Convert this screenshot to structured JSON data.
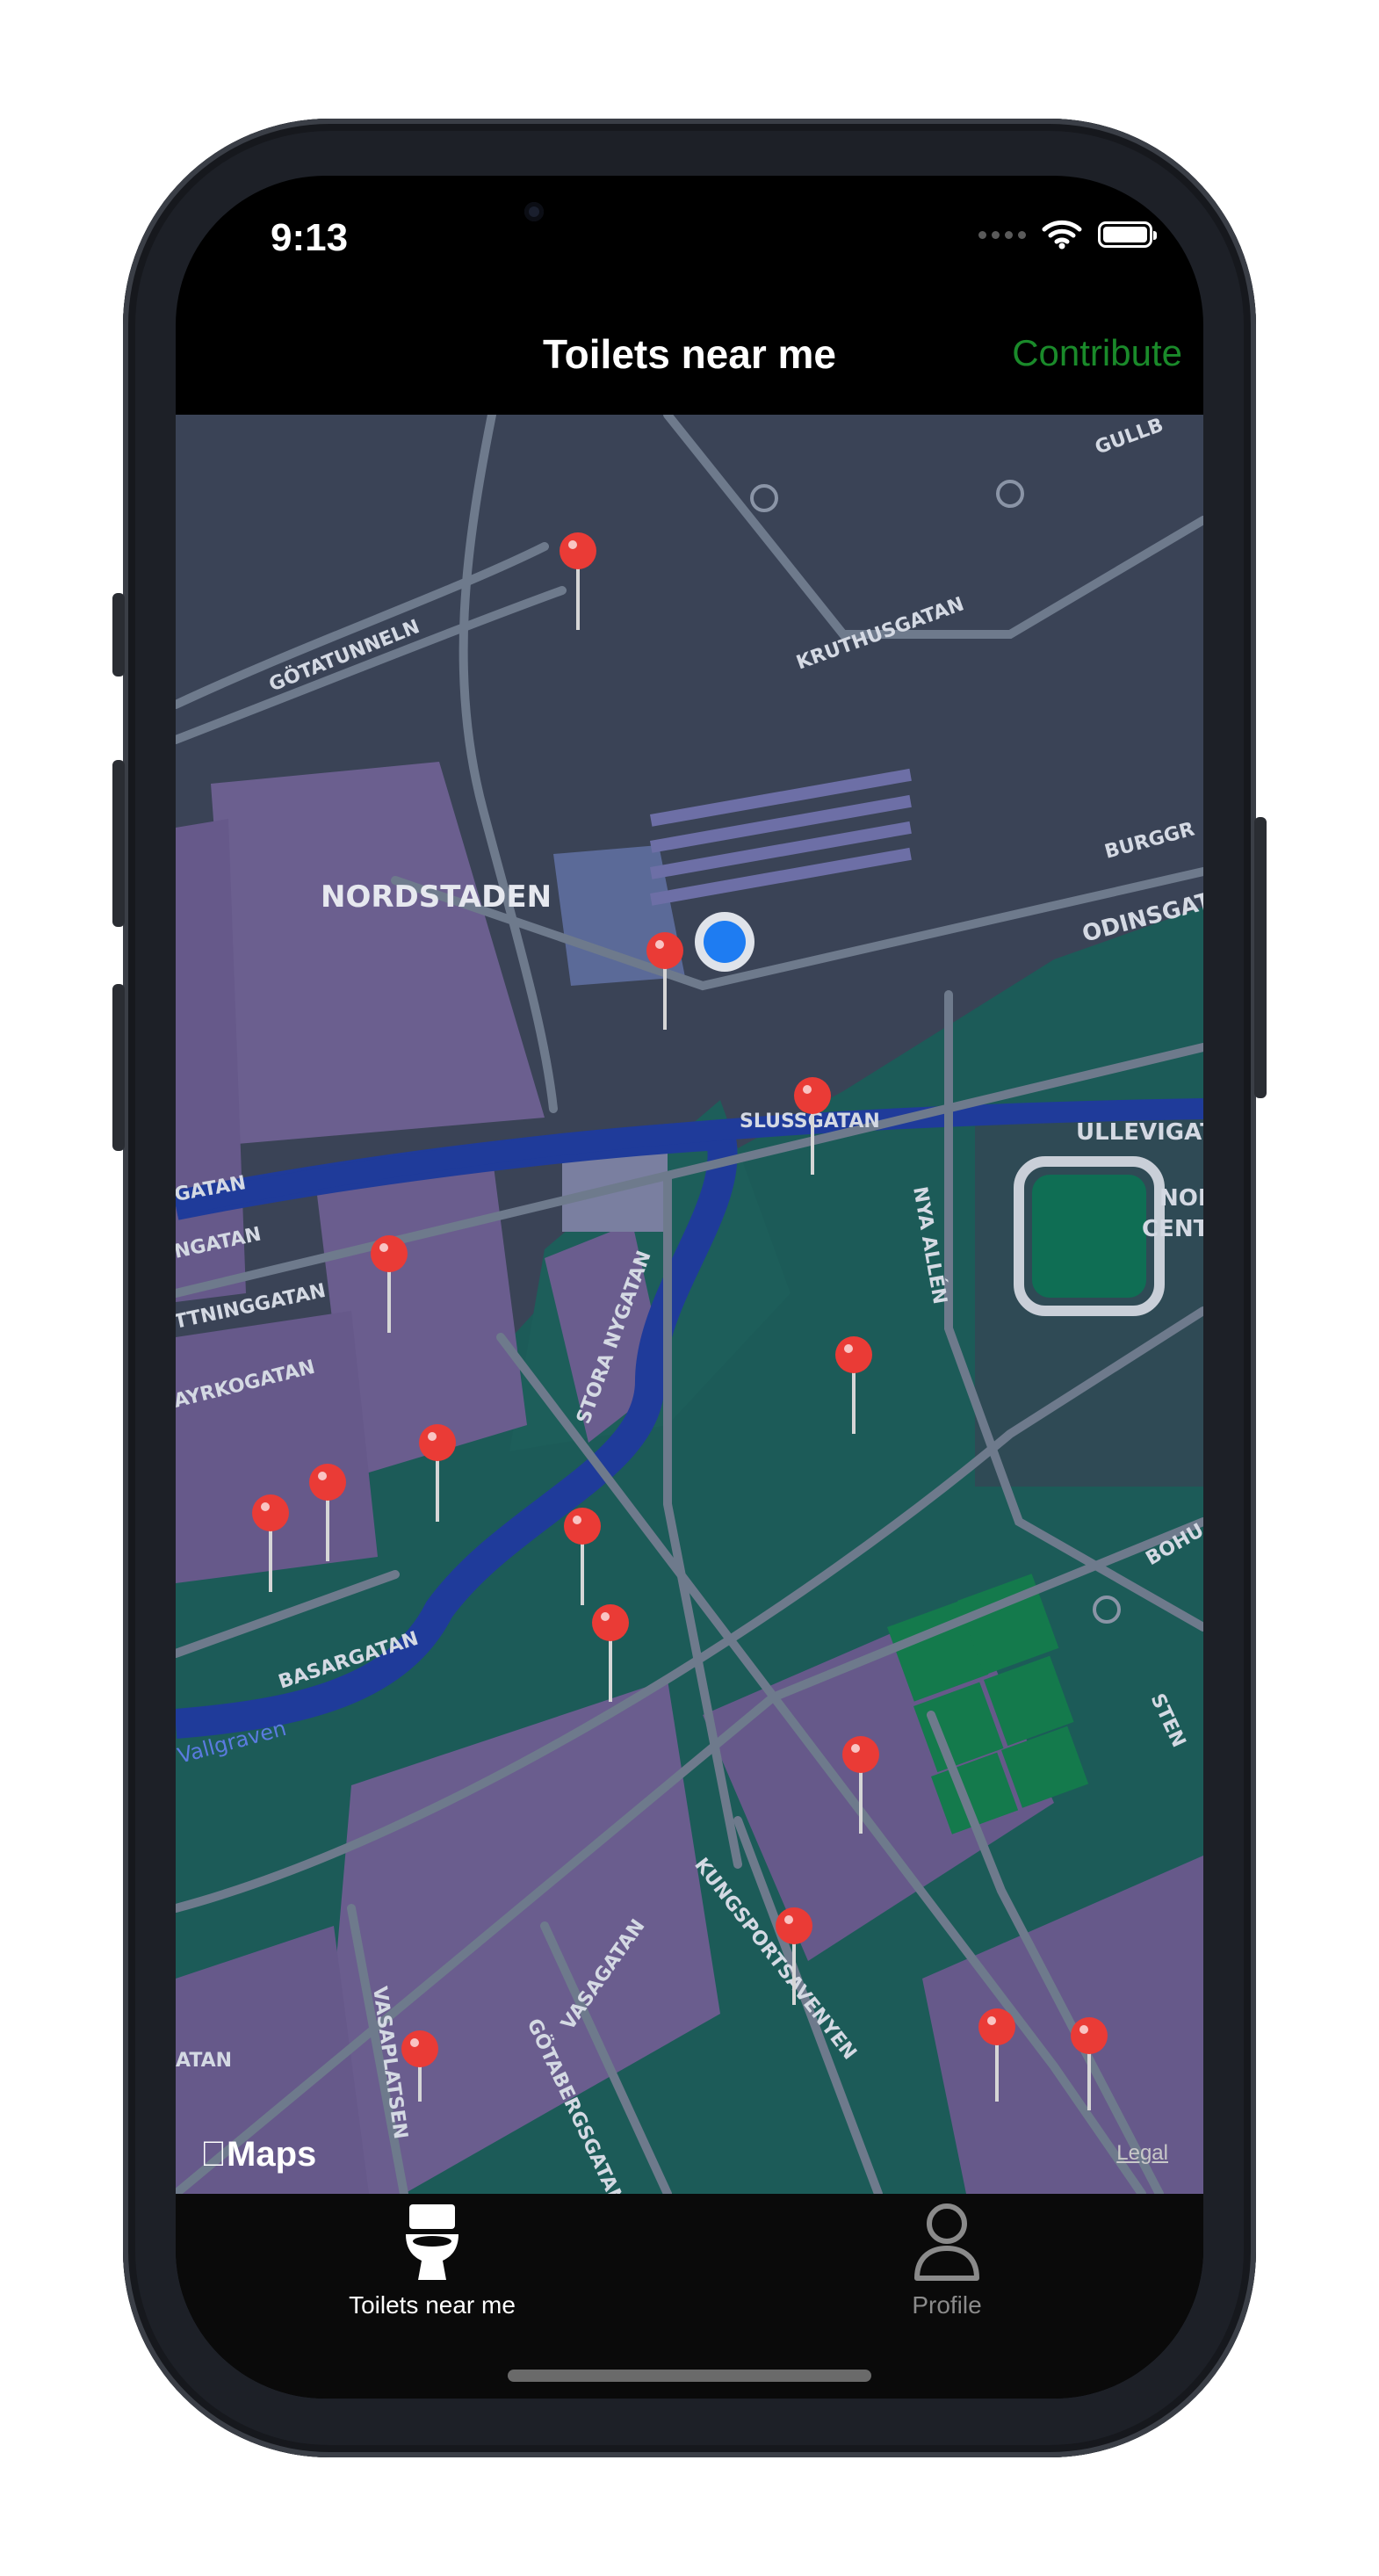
{
  "status_bar": {
    "time": "9:13"
  },
  "nav": {
    "title": "Toilets near me",
    "contribute_label": "Contribute",
    "accent_color": "#1a8a2a"
  },
  "map": {
    "attribution": "Maps",
    "legal_label": "Legal",
    "street_labels": [
      "GÖTATUNNELN",
      "KRUTHUSGATAN",
      "GULLB",
      "NORDSTADEN",
      "BURGGR",
      "ODINSGAT",
      "SLUSSGATAN",
      "ULLEVIGAT",
      "NOR",
      "CENT",
      "GATAN",
      "NGATAN",
      "TTNINGGATAN",
      "AYRKOGATAN",
      "STORA NYGATAN",
      "NYA ALLÉN",
      "BASARGATAN",
      "Vallgraven",
      "BOHU",
      "STEN",
      "KUNGSPORTSAVENYEN",
      "VASAGATAN",
      "GÖTABERGSGATAN",
      "VASAPLATSEN",
      "ATAN"
    ],
    "user_location_color": "#1e7cf2",
    "pin_color": "#ea3b36",
    "toilet_pin_count": 15
  },
  "tabbar": {
    "tabs": [
      {
        "label": "Toilets near me",
        "icon": "toilet-icon",
        "selected": true
      },
      {
        "label": "Profile",
        "icon": "person-icon",
        "selected": false
      }
    ]
  }
}
